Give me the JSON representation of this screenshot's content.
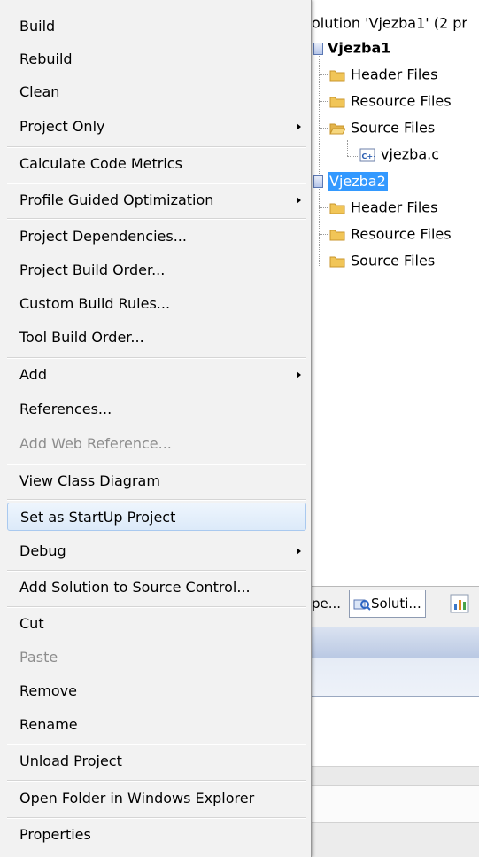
{
  "solution_explorer": {
    "solution_title": "olution 'Vjezba1' (2 pr",
    "tree": [
      {
        "label": "Vjezba1",
        "icon": "project-icon",
        "bold": true
      },
      {
        "label": "Header Files",
        "icon": "folder-icon"
      },
      {
        "label": "Resource Files",
        "icon": "folder-icon"
      },
      {
        "label": "Source Files",
        "icon": "folder-open-icon"
      },
      {
        "label": "vjezba.c",
        "icon": "cpp-file-icon"
      },
      {
        "label": "Vjezba2",
        "icon": "project-icon",
        "selected": true
      },
      {
        "label": "Header Files",
        "icon": "folder-icon"
      },
      {
        "label": "Resource Files",
        "icon": "folder-icon"
      },
      {
        "label": "Source Files",
        "icon": "folder-icon"
      }
    ],
    "tabs": [
      {
        "label": "pe..."
      },
      {
        "label": "Soluti...",
        "icon": "solution-explorer-icon",
        "active": true
      },
      {
        "label": "",
        "icon": "class-view-icon"
      }
    ]
  },
  "context_menu": {
    "items": [
      {
        "label": "Build"
      },
      {
        "label": "Rebuild"
      },
      {
        "label": "Clean"
      },
      {
        "label": "Project Only",
        "submenu": true
      },
      {
        "label": "Calculate Code Metrics"
      },
      {
        "label": "Profile Guided Optimization",
        "submenu": true
      },
      {
        "label": "Project Dependencies..."
      },
      {
        "label": "Project Build Order..."
      },
      {
        "label": "Custom Build Rules..."
      },
      {
        "label": "Tool Build Order..."
      },
      {
        "label": "Add",
        "submenu": true
      },
      {
        "label": "References..."
      },
      {
        "label": "Add Web Reference...",
        "disabled": true
      },
      {
        "label": "View Class Diagram"
      },
      {
        "label": "Set as StartUp Project",
        "highlighted": true
      },
      {
        "label": "Debug",
        "submenu": true
      },
      {
        "label": "Add Solution to Source Control..."
      },
      {
        "label": "Cut"
      },
      {
        "label": "Paste",
        "disabled": true
      },
      {
        "label": "Remove"
      },
      {
        "label": "Rename"
      },
      {
        "label": "Unload Project"
      },
      {
        "label": "Open Folder in Windows Explorer"
      },
      {
        "label": "Properties"
      }
    ]
  },
  "colors": {
    "selection": "#3399ff",
    "menu_background": "#f2f2f2",
    "hover_border": "#a9c9ef",
    "disabled_text": "#8d8d8d",
    "folder": "#e8b84a"
  }
}
